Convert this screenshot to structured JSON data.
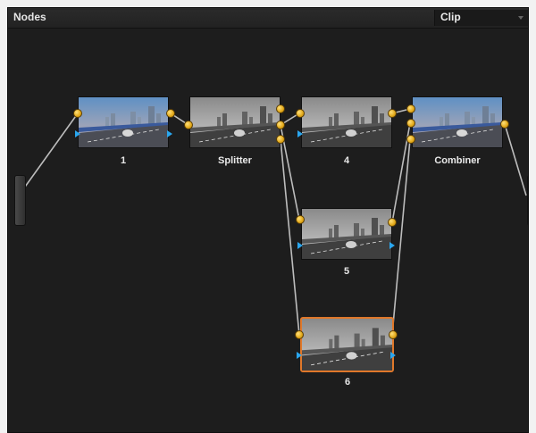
{
  "panel": {
    "title": "Nodes"
  },
  "mode_select": {
    "value": "Clip"
  },
  "nodes": [
    {
      "label": "1",
      "style": "color"
    },
    {
      "label": "Splitter",
      "style": "mono"
    },
    {
      "label": "4",
      "style": "mono"
    },
    {
      "label": "Combiner",
      "style": "color"
    },
    {
      "label": "5",
      "style": "mono"
    },
    {
      "label": "6",
      "style": "mono",
      "selected": true
    }
  ],
  "colors": {
    "background": "#1d1d1d",
    "pin": "#e2a818",
    "selection": "#e0782a",
    "rgb_input": "#2aa6ee",
    "wire": "#bdbdbd"
  },
  "icons": [
    "input-pin-icon",
    "output-pin-icon",
    "rgb-input-icon",
    "rgb-output-icon"
  ]
}
